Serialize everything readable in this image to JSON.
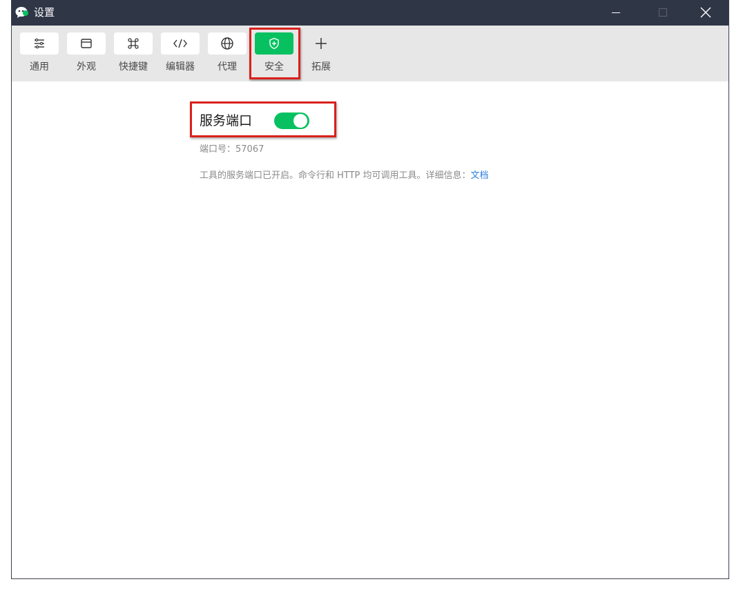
{
  "window": {
    "title": "设置",
    "app_icon": "wechat-devtools-icon"
  },
  "title_controls": {
    "minimize_icon": "minimize-icon",
    "maximize_icon": "maximize-icon",
    "close_icon": "close-icon"
  },
  "tabs": [
    {
      "label": "通用",
      "icon": "sliders-icon",
      "active": false
    },
    {
      "label": "外观",
      "icon": "window-icon",
      "active": false
    },
    {
      "label": "快捷键",
      "icon": "command-key-icon",
      "active": false
    },
    {
      "label": "编辑器",
      "icon": "code-icon",
      "active": false
    },
    {
      "label": "代理",
      "icon": "globe-icon",
      "active": false
    },
    {
      "label": "安全",
      "icon": "shield-plus-icon",
      "active": true
    },
    {
      "label": "拓展",
      "icon": "plus-icon",
      "active": false
    }
  ],
  "security": {
    "service_port_label": "服务端口",
    "service_port_enabled": true,
    "port_text": "端口号：57067",
    "description": "工具的服务端口已开启。命令行和 HTTP 均可调用工具。详细信息：",
    "doc_link": "文档"
  },
  "colors": {
    "titlebar": "#2f3646",
    "toolbar": "#e7e7e7",
    "accent_green": "#07c160",
    "highlight_red": "#d9201c",
    "link_blue": "#2e7fe0"
  }
}
